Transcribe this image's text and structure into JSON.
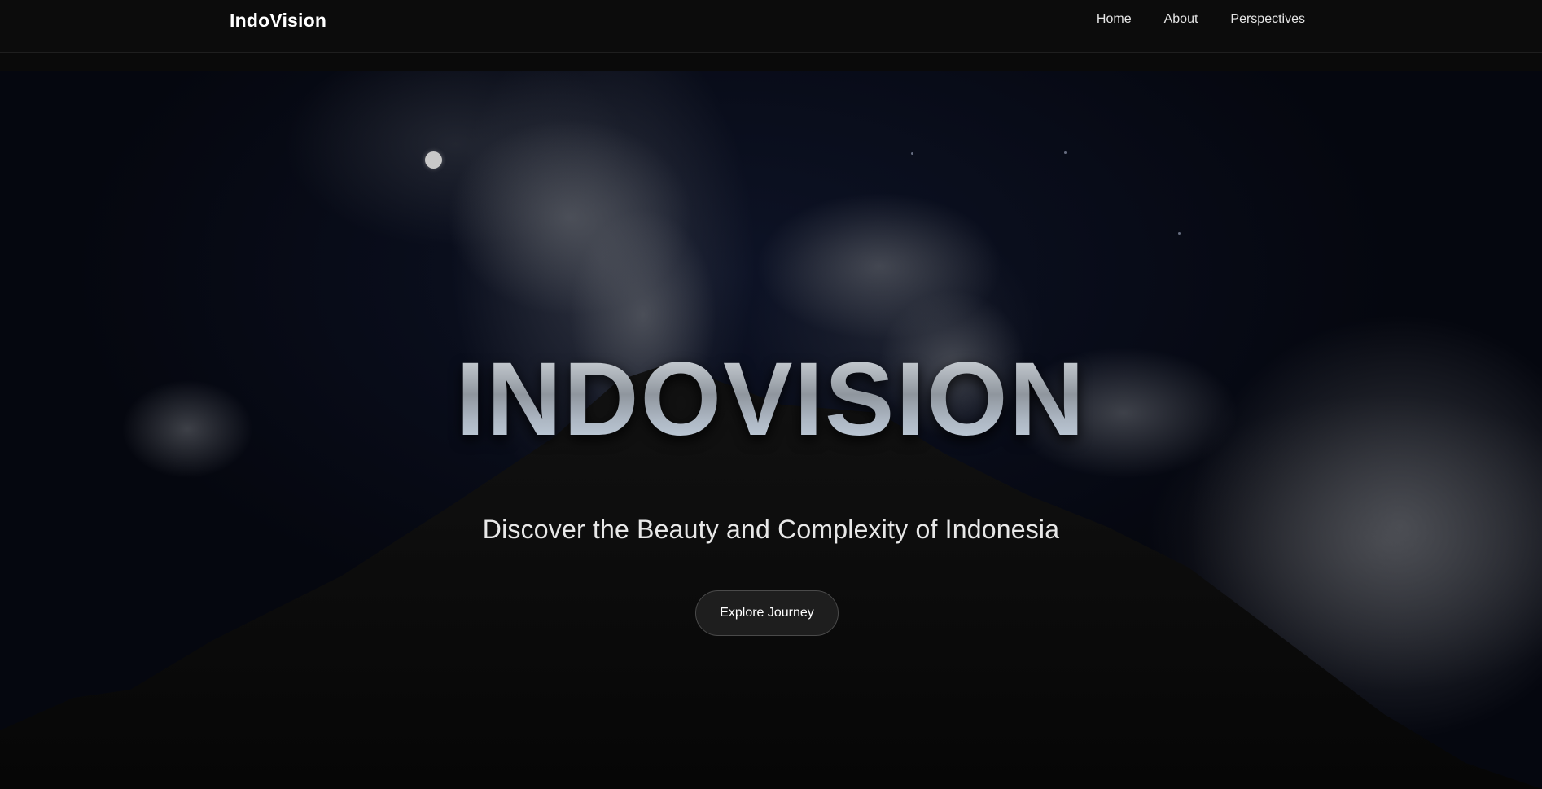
{
  "nav": {
    "brand": "IndoVision",
    "links": [
      {
        "label": "Home"
      },
      {
        "label": "About"
      },
      {
        "label": "Perspectives"
      }
    ]
  },
  "hero": {
    "title": "INDOVISION",
    "subtitle": "Discover the Beauty and Complexity of Indonesia",
    "cta_label": "Explore Journey",
    "background_icon": "volcano-night-image"
  },
  "colors": {
    "background": "#0b0b0b",
    "navbar": "#0c0c0c",
    "button_bg": "#1e1e1e",
    "button_border": "#4a4a4a",
    "title_metal": "#b8c0c8"
  }
}
